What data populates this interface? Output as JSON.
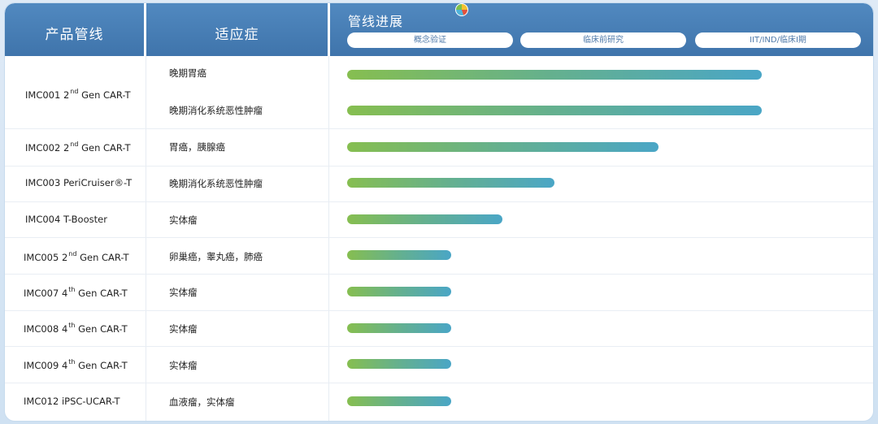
{
  "header": {
    "product_col": "产品管线",
    "indication_col": "适应症",
    "pipeline_col": "管线进展",
    "stages": [
      "概念验证",
      "临床前研究",
      "IIT/IND/临床Ⅰ期"
    ]
  },
  "colors": {
    "header_blue": "#4a82ba",
    "bar_start": "#86be50",
    "bar_end": "#4aa6c6"
  },
  "products": [
    {
      "name": "IMC001 2",
      "sup": "nd",
      "suffix": " Gen CAR-T"
    },
    {
      "name": "IMC002 2",
      "sup": "nd",
      "suffix": "  Gen CAR-T"
    },
    {
      "name": "IMC003 PeriCruiser®-T",
      "sup": "",
      "suffix": ""
    },
    {
      "name": "IMC004 T-Booster",
      "sup": "",
      "suffix": ""
    },
    {
      "name": "IMC005 2",
      "sup": "nd",
      "suffix": " Gen CAR-T"
    },
    {
      "name": "IMC007 4",
      "sup": "th",
      "suffix": " Gen CAR-T"
    },
    {
      "name": "IMC008 4",
      "sup": "th",
      "suffix": " Gen CAR-T"
    },
    {
      "name": "IMC009 4",
      "sup": "th",
      "suffix": " Gen CAR-T"
    },
    {
      "name": "IMC012 iPSC-UCAR-T",
      "sup": "",
      "suffix": ""
    }
  ],
  "chart_data": {
    "type": "bar",
    "orientation": "horizontal",
    "title": "管线进展",
    "stages": [
      "概念验证",
      "临床前研究",
      "IIT/IND/临床Ⅰ期"
    ],
    "xlim": [
      0,
      3
    ],
    "categories": [
      "晚期胃癌",
      "晚期消化系统恶性肿瘤",
      "胃癌，胰腺癌",
      "晚期消化系统恶性肿瘤",
      "实体瘤",
      "卵巢癌，睾丸癌，肺癌",
      "实体瘤",
      "实体瘤",
      "实体瘤",
      "血液瘤，实体瘤"
    ],
    "products": [
      "IMC001",
      "IMC001",
      "IMC002",
      "IMC003",
      "IMC004",
      "IMC005",
      "IMC007",
      "IMC008",
      "IMC009",
      "IMC012"
    ],
    "values": [
      2.4,
      2.4,
      1.8,
      1.2,
      0.9,
      0.6,
      0.6,
      0.6,
      0.6,
      0.6
    ]
  }
}
